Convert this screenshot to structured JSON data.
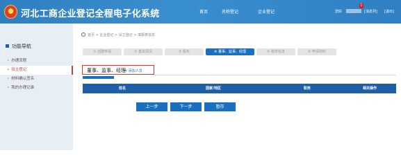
{
  "header": {
    "title": "河北工商企业登记全程电子化系统",
    "nav": [
      "首页",
      "名称登记",
      "企业登记"
    ],
    "greeting": "您好",
    "badge_count": "1",
    "messages": "[消息列]",
    "exit": "[退出]"
  },
  "sidebar": {
    "heading": "功能导航",
    "items": [
      {
        "label": "办理流程"
      },
      {
        "label": "设立登记"
      },
      {
        "label": "材料确认签名"
      },
      {
        "label": "我的办理记录"
      }
    ]
  },
  "breadcrumb": "首页 > 企业登记 > 设立登记 > 填报表信息",
  "steps": [
    {
      "label": "① 创建申请"
    },
    {
      "label": "② 基本情况"
    },
    {
      "label": "③ 股东"
    },
    {
      "label": "④ 董事、监事、经理"
    },
    {
      "label": "⑤ 税务信息"
    },
    {
      "label": "⑥ 申请材料"
    }
  ],
  "section": {
    "title": "董事、监事、经理",
    "add_link": "+ 添加人员"
  },
  "table": {
    "columns": [
      "姓名",
      "国家/地区",
      "职务",
      "相关操作"
    ]
  },
  "buttons": {
    "prev": "上一步",
    "next": "下一步",
    "save": "暂存"
  }
}
